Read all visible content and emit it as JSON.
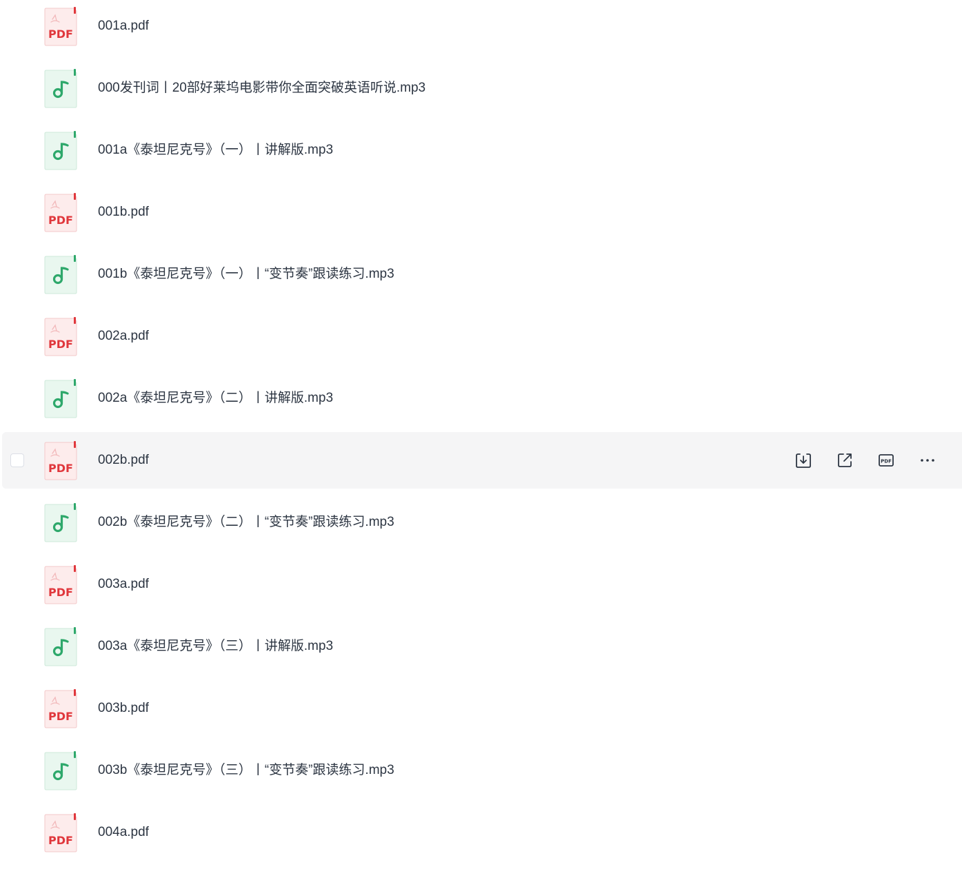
{
  "colors": {
    "pdf_red": "#e0373c",
    "audio_green": "#2ea86b",
    "text": "#2c3542",
    "hover_bg": "#f5f5f6"
  },
  "files": [
    {
      "name": "001a.pdf",
      "type": "pdf",
      "icon": "pdf-file-icon",
      "badge": "PDF"
    },
    {
      "name": "000发刊词丨20部好莱坞电影带你全面突破英语听说.mp3",
      "type": "audio",
      "icon": "music-note-icon"
    },
    {
      "name": "001a《泰坦尼克号》（一）丨讲解版.mp3",
      "type": "audio",
      "icon": "music-note-icon"
    },
    {
      "name": "001b.pdf",
      "type": "pdf",
      "icon": "pdf-file-icon",
      "badge": "PDF"
    },
    {
      "name": "001b《泰坦尼克号》（一）丨“变节奏”跟读练习.mp3",
      "type": "audio",
      "icon": "music-note-icon"
    },
    {
      "name": "002a.pdf",
      "type": "pdf",
      "icon": "pdf-file-icon",
      "badge": "PDF"
    },
    {
      "name": "002a《泰坦尼克号》（二）丨讲解版.mp3",
      "type": "audio",
      "icon": "music-note-icon"
    },
    {
      "name": "002b.pdf",
      "type": "pdf",
      "icon": "pdf-file-icon",
      "badge": "PDF",
      "hovered": true
    },
    {
      "name": "002b《泰坦尼克号》（二）丨“变节奏”跟读练习.mp3",
      "type": "audio",
      "icon": "music-note-icon"
    },
    {
      "name": "003a.pdf",
      "type": "pdf",
      "icon": "pdf-file-icon",
      "badge": "PDF"
    },
    {
      "name": "003a《泰坦尼克号》（三）丨讲解版.mp3",
      "type": "audio",
      "icon": "music-note-icon"
    },
    {
      "name": "003b.pdf",
      "type": "pdf",
      "icon": "pdf-file-icon",
      "badge": "PDF"
    },
    {
      "name": "003b《泰坦尼克号》（三）丨“变节奏”跟读练习.mp3",
      "type": "audio",
      "icon": "music-note-icon"
    },
    {
      "name": "004a.pdf",
      "type": "pdf",
      "icon": "pdf-file-icon",
      "badge": "PDF"
    }
  ],
  "row_actions": [
    {
      "name": "download-button",
      "icon": "download-icon"
    },
    {
      "name": "share-button",
      "icon": "share-icon"
    },
    {
      "name": "pdf-tool-button",
      "icon": "pdf-icon",
      "label": "PDF"
    },
    {
      "name": "more-button",
      "icon": "more-icon"
    }
  ]
}
